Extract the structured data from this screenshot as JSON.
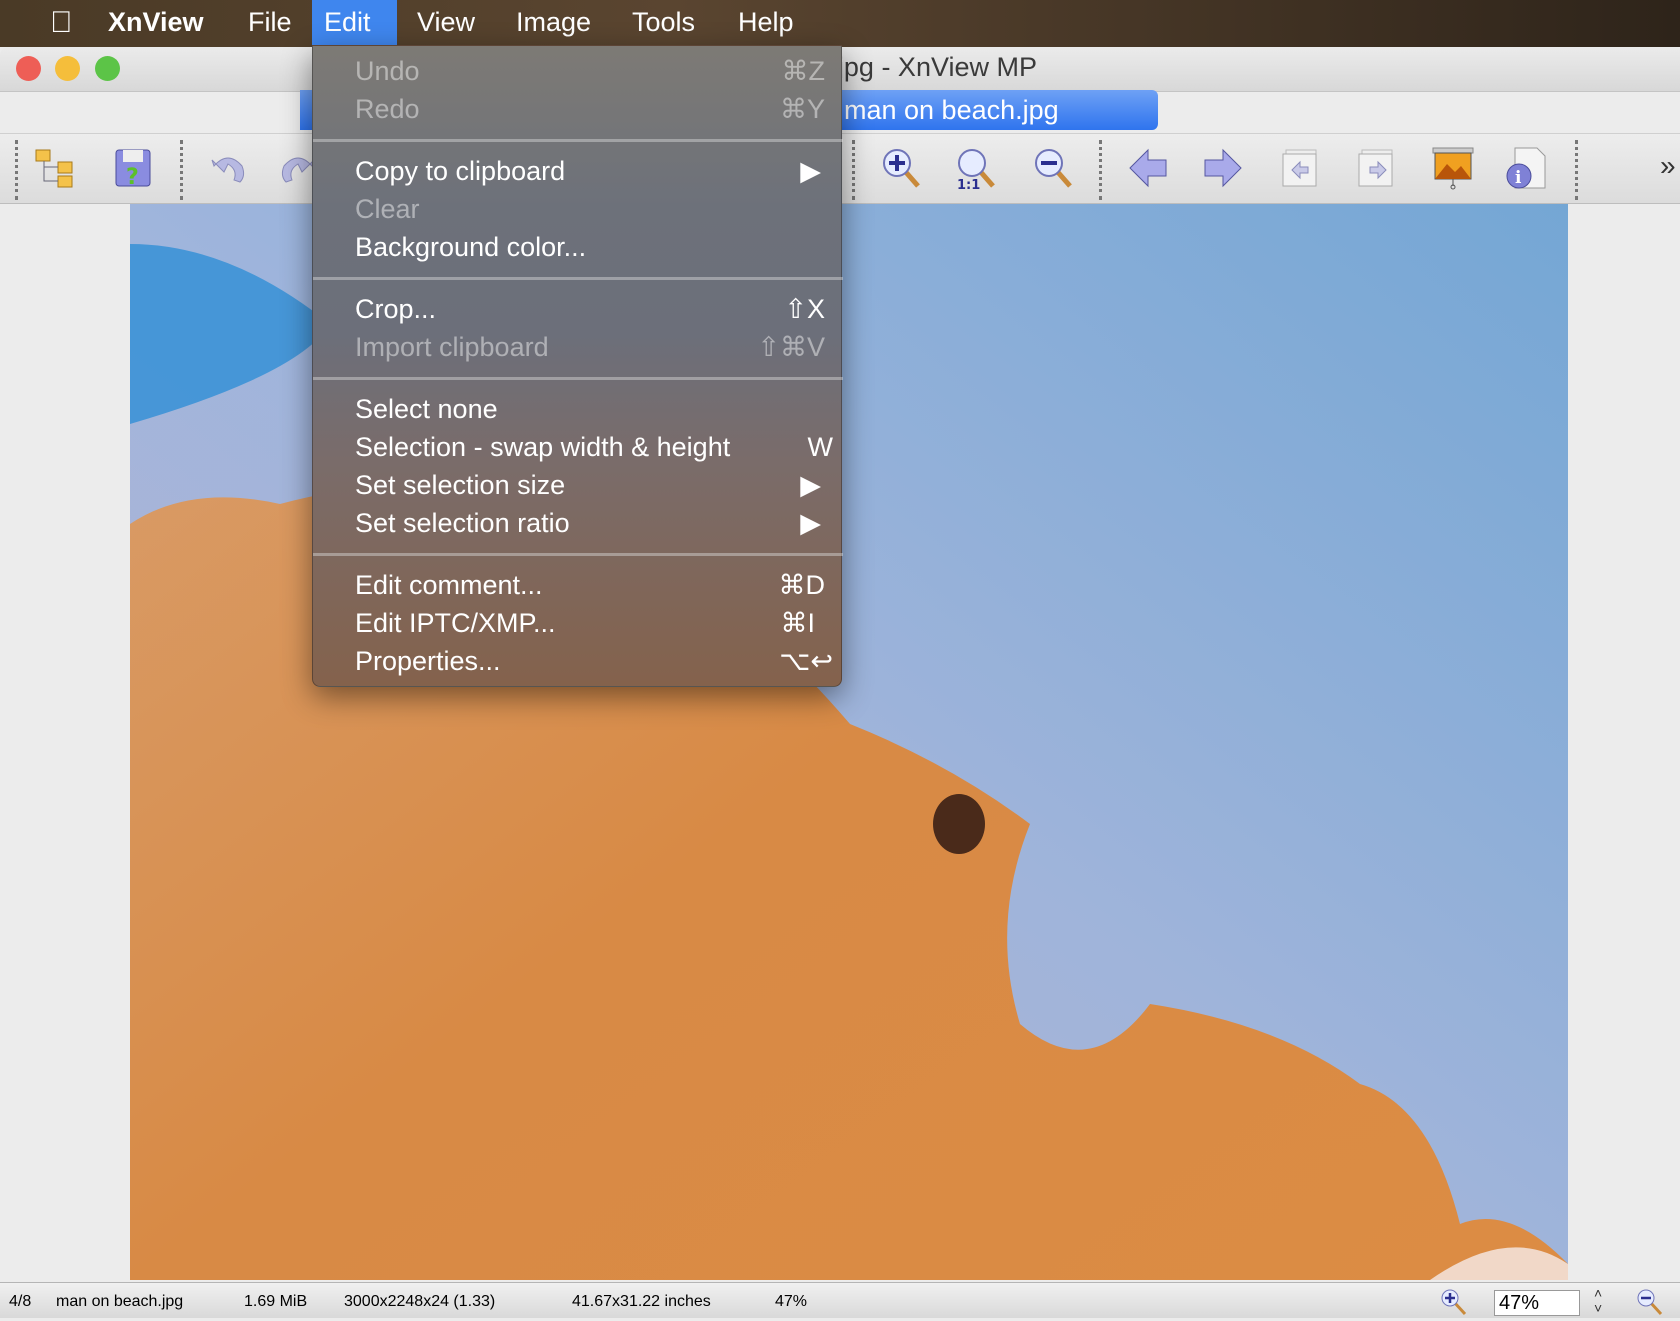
{
  "menubar": {
    "apple": "apple-icon",
    "app": "XnView",
    "items": [
      "File",
      "Edit",
      "View",
      "Image",
      "Tools",
      "Help"
    ],
    "active": "Edit"
  },
  "window": {
    "title": "man on beach.jpg - XnView MP",
    "tab": "man on beach.jpg"
  },
  "toolbar": {
    "icons": [
      "browser-folders-icon",
      "save-icon",
      "undo-icon",
      "redo-icon",
      "zoom-in-icon",
      "zoom-1-1-icon",
      "zoom-out-icon",
      "previous-icon",
      "next-icon",
      "first-image-icon",
      "last-image-icon",
      "slideshow-icon",
      "info-icon"
    ],
    "zoom_1_1_label": "1:1",
    "overflow": "»"
  },
  "edit_menu": {
    "groups": [
      [
        {
          "label": "Undo",
          "shortcut": "⌘Z",
          "disabled": true
        },
        {
          "label": "Redo",
          "shortcut": "⌘Y",
          "disabled": true
        }
      ],
      [
        {
          "label": "Copy to clipboard",
          "shortcut": "▶",
          "disabled": false
        },
        {
          "label": "Clear",
          "shortcut": "",
          "disabled": true
        },
        {
          "label": "Background color...",
          "shortcut": "",
          "disabled": false
        }
      ],
      [
        {
          "label": "Crop...",
          "shortcut": "⇧X",
          "disabled": false
        },
        {
          "label": "Import clipboard",
          "shortcut": "⇧⌘V",
          "disabled": true
        }
      ],
      [
        {
          "label": "Select none",
          "shortcut": "",
          "disabled": false
        },
        {
          "label": "Selection - swap width & height",
          "shortcut": "W",
          "disabled": false
        },
        {
          "label": "Set selection size",
          "shortcut": "▶",
          "disabled": false
        },
        {
          "label": "Set selection ratio",
          "shortcut": "▶",
          "disabled": false
        }
      ],
      [
        {
          "label": "Edit comment...",
          "shortcut": "⌘D",
          "disabled": false
        },
        {
          "label": "Edit IPTC/XMP...",
          "shortcut": "⌘I",
          "disabled": false
        },
        {
          "label": "Properties...",
          "shortcut": "⌥↩",
          "disabled": false
        }
      ]
    ]
  },
  "status": {
    "index": "4/8",
    "filename": "man on beach.jpg",
    "size": "1.69 MiB",
    "dimensions": "3000x2248x24 (1.33)",
    "print_size": "41.67x31.22 inches",
    "zoom": "47%"
  },
  "zoom_control": {
    "value": "47%"
  },
  "colors": {
    "accent": "#3f86ee",
    "sand": "#d98a45",
    "water": "#5fa0d8"
  }
}
